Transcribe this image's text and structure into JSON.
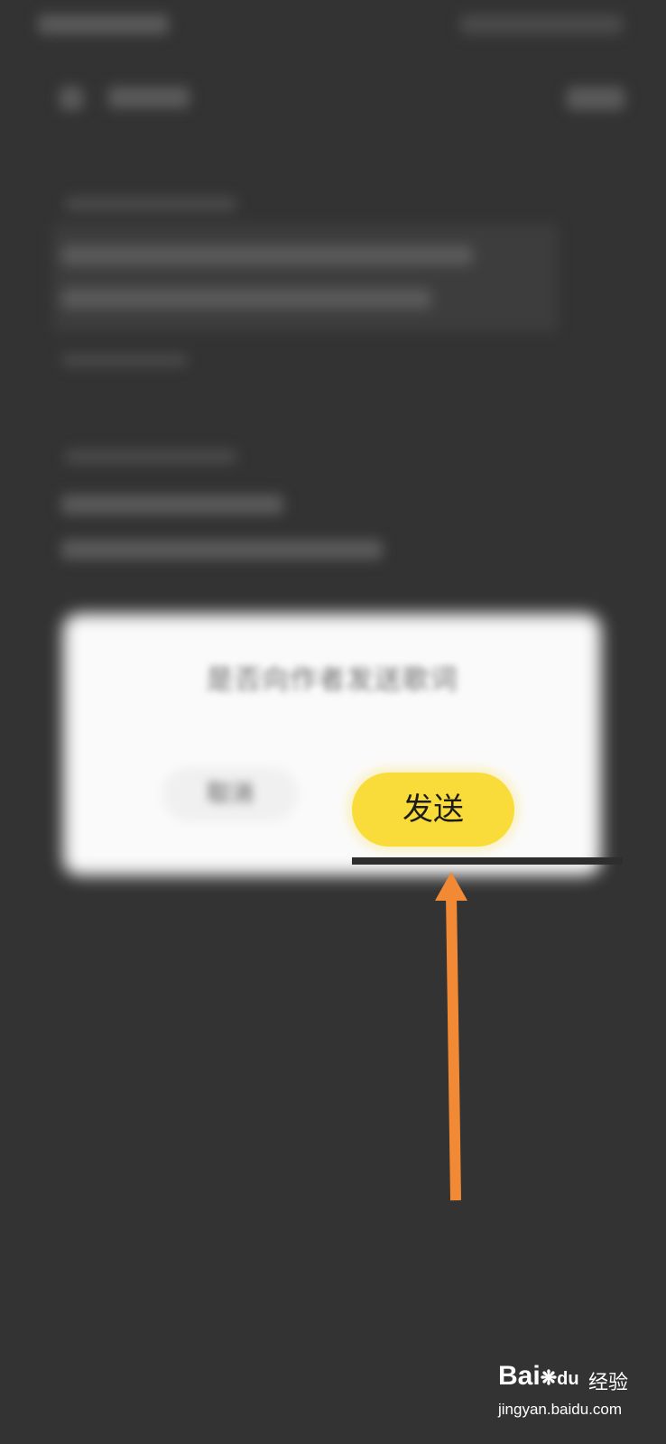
{
  "dialog": {
    "message": "是否向作者发送歌词",
    "cancel_label": "取消",
    "send_label": "发送"
  },
  "annotation": {
    "arrow_color": "#f28a35"
  },
  "watermark": {
    "logo": "Bai",
    "logo_tail": "du",
    "cn": "经验",
    "url": "jingyan.baidu.com"
  },
  "colors": {
    "background": "#333333",
    "send_button": "#f9dc3a"
  }
}
